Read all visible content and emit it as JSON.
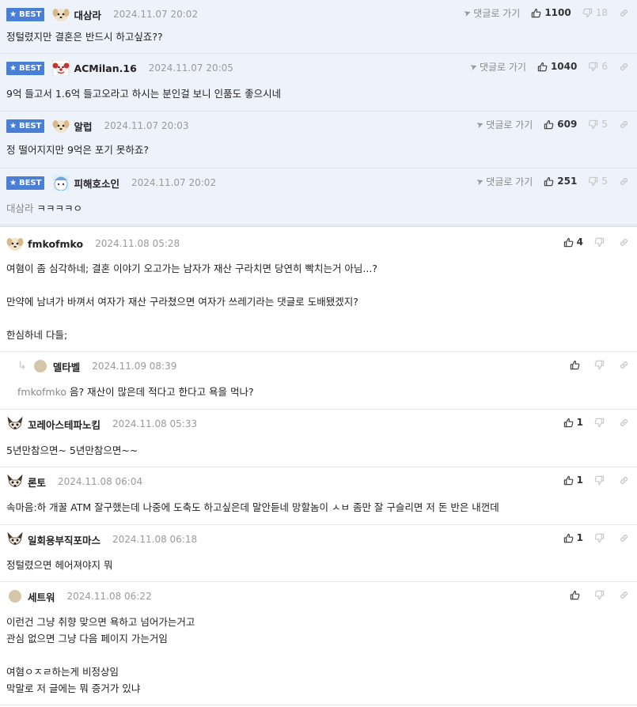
{
  "labels": {
    "best": "BEST",
    "goto_reply": "댓글로 가기"
  },
  "colors": {
    "best_bg": "#eef2fb",
    "badge": "#4a7fd6"
  },
  "comments": [
    {
      "nick": "대삼라",
      "date": "2024.11.07 20:02",
      "best": true,
      "up": "1100",
      "down": "18",
      "avatar": "dog-avatar",
      "lines": [
        "정털렸지만 결혼은 반드시 하고싶죠??"
      ]
    },
    {
      "nick": "ACMilan.16",
      "date": "2024.11.07 20:05",
      "best": true,
      "up": "1040",
      "down": "6",
      "avatar": "clown-avatar",
      "lines": [
        "9억 들고서 1.6억 들고오라고 하시는 분인걸 보니 인품도 좋으시네"
      ]
    },
    {
      "nick": "알럽",
      "date": "2024.11.07 20:03",
      "best": true,
      "up": "609",
      "down": "5",
      "avatar": "dog-avatar",
      "lines": [
        "정 떨어지지만 9억은 포기 못하죠?"
      ]
    },
    {
      "nick": "피해호소인",
      "date": "2024.11.07 20:02",
      "best": true,
      "up": "251",
      "down": "5",
      "avatar": "blue-character-avatar",
      "mention": "대삼라",
      "lines": [
        "ㅋㅋㅋㅋㅇ"
      ]
    },
    {
      "nick": "fmkofmko",
      "date": "2024.11.08 05:28",
      "best": false,
      "up": "4",
      "down": "",
      "avatar": "dog-avatar",
      "lines": [
        "여혐이 좀 심각하네; 결혼 이야기 오고가는 남자가 재산 구라치면 당연히 빡치는거 아님...?",
        "",
        "만약에 남녀가 바껴서 여자가 재산 구라쳤으면 여자가 쓰레기라는 댓글로 도배됐겠지?",
        "",
        "한심하네 다들;"
      ]
    },
    {
      "nick": "델타벨",
      "date": "2024.11.09 08:39",
      "best": false,
      "reply": true,
      "up": "",
      "down": "",
      "avatar": "plain-avatar",
      "mention": "fmkofmko",
      "lines": [
        "음? 재산이 많은데 적다고 한다고 욕을 먹나?"
      ]
    },
    {
      "nick": "꼬레아스테파노킴",
      "date": "2024.11.08 05:33",
      "best": false,
      "up": "1",
      "down": "",
      "avatar": "fox-avatar",
      "lines": [
        "5년만참으면~ 5년만참으면~~"
      ]
    },
    {
      "nick": "론토",
      "date": "2024.11.08 06:04",
      "best": false,
      "up": "1",
      "down": "",
      "avatar": "fox-avatar",
      "lines": [
        "속마음:하 개꿀 ATM 잘구했는데 나중에 도축도 하고싶은데 말안듣네 망할놈이 ㅅㅂ 좀만 잘 구슬리면 저 돈 반은 내껀데"
      ]
    },
    {
      "nick": "일회용부직포마스",
      "date": "2024.11.08 06:18",
      "best": false,
      "up": "1",
      "down": "",
      "avatar": "fox-avatar",
      "lines": [
        "정털렸으면 헤어져야지 뭐"
      ]
    },
    {
      "nick": "세트워",
      "date": "2024.11.08 06:22",
      "best": false,
      "up": "",
      "down": "",
      "avatar": "plain-avatar",
      "lines": [
        "이런건 그냥 취향 맞으면 욕하고 넘어가는거고",
        "관심 없으면 그냥 다음 페이지 가는거임",
        "",
        "여혐ㅇㅈㄹ하는게 비정상임",
        "막말로 저 글에는 뭐 증거가 있냐"
      ]
    }
  ]
}
